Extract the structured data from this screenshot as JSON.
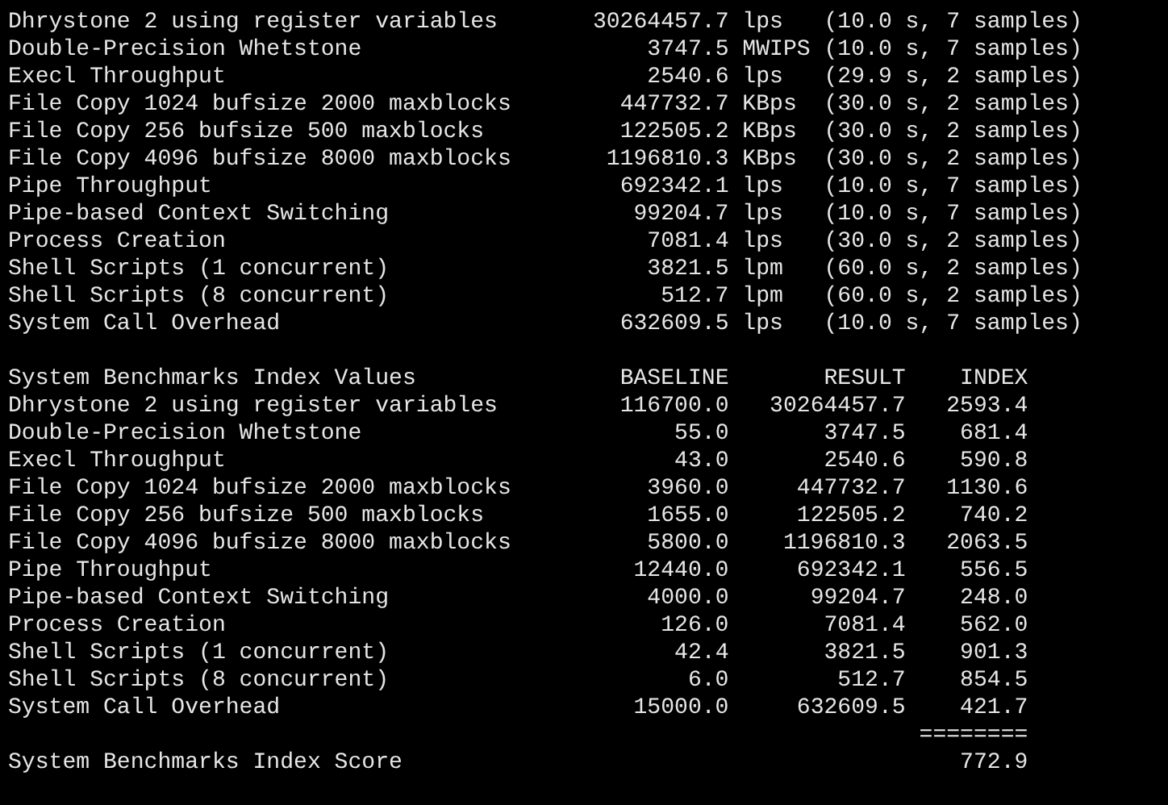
{
  "tests": [
    {
      "name": "Dhrystone 2 using register variables",
      "value": "30264457.7",
      "unit": "lps",
      "timing": "(10.0 s, 7 samples)"
    },
    {
      "name": "Double-Precision Whetstone",
      "value": "3747.5",
      "unit": "MWIPS",
      "timing": "(10.0 s, 7 samples)"
    },
    {
      "name": "Execl Throughput",
      "value": "2540.6",
      "unit": "lps",
      "timing": "(29.9 s, 2 samples)"
    },
    {
      "name": "File Copy 1024 bufsize 2000 maxblocks",
      "value": "447732.7",
      "unit": "KBps",
      "timing": "(30.0 s, 2 samples)"
    },
    {
      "name": "File Copy 256 bufsize 500 maxblocks",
      "value": "122505.2",
      "unit": "KBps",
      "timing": "(30.0 s, 2 samples)"
    },
    {
      "name": "File Copy 4096 bufsize 8000 maxblocks",
      "value": "1196810.3",
      "unit": "KBps",
      "timing": "(30.0 s, 2 samples)"
    },
    {
      "name": "Pipe Throughput",
      "value": "692342.1",
      "unit": "lps",
      "timing": "(10.0 s, 7 samples)"
    },
    {
      "name": "Pipe-based Context Switching",
      "value": "99204.7",
      "unit": "lps",
      "timing": "(10.0 s, 7 samples)"
    },
    {
      "name": "Process Creation",
      "value": "7081.4",
      "unit": "lps",
      "timing": "(30.0 s, 2 samples)"
    },
    {
      "name": "Shell Scripts (1 concurrent)",
      "value": "3821.5",
      "unit": "lpm",
      "timing": "(60.0 s, 2 samples)"
    },
    {
      "name": "Shell Scripts (8 concurrent)",
      "value": "512.7",
      "unit": "lpm",
      "timing": "(60.0 s, 2 samples)"
    },
    {
      "name": "System Call Overhead",
      "value": "632609.5",
      "unit": "lps",
      "timing": "(10.0 s, 7 samples)"
    }
  ],
  "index_table": {
    "title": "System Benchmarks Index Values",
    "columns": [
      "BASELINE",
      "RESULT",
      "INDEX"
    ],
    "rows": [
      {
        "name": "Dhrystone 2 using register variables",
        "baseline": "116700.0",
        "result": "30264457.7",
        "index": "2593.4"
      },
      {
        "name": "Double-Precision Whetstone",
        "baseline": "55.0",
        "result": "3747.5",
        "index": "681.4"
      },
      {
        "name": "Execl Throughput",
        "baseline": "43.0",
        "result": "2540.6",
        "index": "590.8"
      },
      {
        "name": "File Copy 1024 bufsize 2000 maxblocks",
        "baseline": "3960.0",
        "result": "447732.7",
        "index": "1130.6"
      },
      {
        "name": "File Copy 256 bufsize 500 maxblocks",
        "baseline": "1655.0",
        "result": "122505.2",
        "index": "740.2"
      },
      {
        "name": "File Copy 4096 bufsize 8000 maxblocks",
        "baseline": "5800.0",
        "result": "1196810.3",
        "index": "2063.5"
      },
      {
        "name": "Pipe Throughput",
        "baseline": "12440.0",
        "result": "692342.1",
        "index": "556.5"
      },
      {
        "name": "Pipe-based Context Switching",
        "baseline": "4000.0",
        "result": "99204.7",
        "index": "248.0"
      },
      {
        "name": "Process Creation",
        "baseline": "126.0",
        "result": "7081.4",
        "index": "562.0"
      },
      {
        "name": "Shell Scripts (1 concurrent)",
        "baseline": "42.4",
        "result": "3821.5",
        "index": "901.3"
      },
      {
        "name": "Shell Scripts (8 concurrent)",
        "baseline": "6.0",
        "result": "512.7",
        "index": "854.5"
      },
      {
        "name": "System Call Overhead",
        "baseline": "15000.0",
        "result": "632609.5",
        "index": "421.7"
      }
    ],
    "separator": "========",
    "score": {
      "label": "System Benchmarks Index Score",
      "value": "772.9"
    }
  }
}
